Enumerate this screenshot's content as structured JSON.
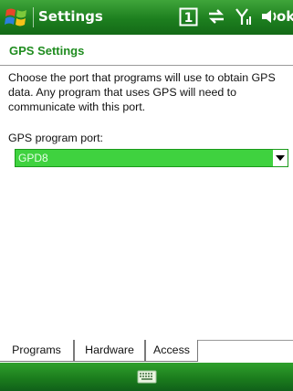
{
  "titlebar": {
    "app_title": "Settings",
    "ok_label": "ok",
    "status_icons": [
      "window-indicator-icon",
      "sync-arrows-icon",
      "signal-icon",
      "volume-icon"
    ],
    "window_indicator_value": "1"
  },
  "page": {
    "title": "GPS Settings",
    "description": "Choose the port that programs will use to obtain GPS data. Any program that uses GPS will need to communicate with this port.",
    "field_label": "GPS program port:",
    "port_value": "GPD8"
  },
  "tabs": [
    {
      "label": "Programs",
      "active": true
    },
    {
      "label": "Hardware",
      "active": false
    },
    {
      "label": "Access",
      "active": false
    }
  ],
  "colors": {
    "accent": "#1f8c1f",
    "titlebar": "#1d7f1f",
    "select_highlight": "#3fd23f"
  },
  "softkeys": {
    "center_icon": "keyboard-icon"
  }
}
